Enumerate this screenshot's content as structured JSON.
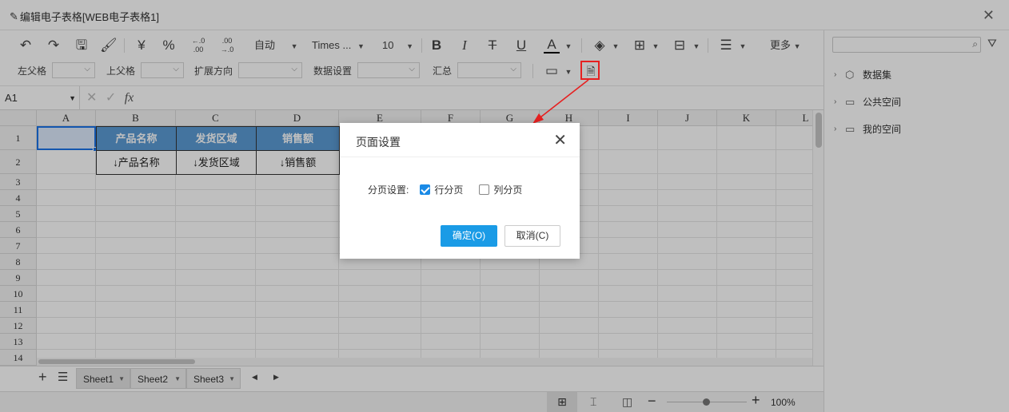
{
  "window": {
    "title": "编辑电子表格[WEB电子表格1]"
  },
  "toolbar": {
    "auto_label": "自动",
    "font_name": "Times ...",
    "font_size": "10",
    "bold": "B",
    "italic": "I",
    "strike": "T",
    "underline": "U",
    "font_color": "A",
    "more_label": "更多",
    "yen": "¥",
    "percent": "%",
    "left_parent_label": "左父格",
    "top_parent_label": "上父格",
    "expand_direction_label": "扩展方向",
    "data_setting_label": "数据设置",
    "summary_label": "汇总"
  },
  "formula_bar": {
    "cell_ref": "A1",
    "fx": "fx"
  },
  "grid": {
    "columns": [
      "A",
      "B",
      "C",
      "D",
      "E",
      "F",
      "G",
      "H",
      "I",
      "J",
      "K",
      "L"
    ],
    "rows": [
      "1",
      "2",
      "3",
      "4",
      "5",
      "6",
      "7",
      "8",
      "9",
      "10",
      "11",
      "12",
      "13",
      "14"
    ],
    "header_cells": [
      "产品名称",
      "发货区域",
      "销售额"
    ],
    "data_cells": [
      "↓产品名称",
      "↓发货区域",
      "↓销售额"
    ]
  },
  "sheets": {
    "tabs": [
      "Sheet1",
      "Sheet2",
      "Sheet3"
    ],
    "active": "Sheet1"
  },
  "status": {
    "zoom": "100%"
  },
  "right_panel": {
    "tree": [
      {
        "label": "数据集",
        "icon": "cube-icon"
      },
      {
        "label": "公共空间",
        "icon": "folder-icon"
      },
      {
        "label": "我的空间",
        "icon": "user-folder-icon"
      }
    ]
  },
  "dialog": {
    "title": "页面设置",
    "paging_label": "分页设置:",
    "row_paging_label": "行分页",
    "row_paging_checked": true,
    "col_paging_label": "列分页",
    "col_paging_checked": false,
    "ok_label": "确定(O)",
    "cancel_label": "取消(C)"
  },
  "colors": {
    "header_fill": "#5b9bd5",
    "primary_button": "#1a9be6",
    "highlight": "#e62020"
  }
}
